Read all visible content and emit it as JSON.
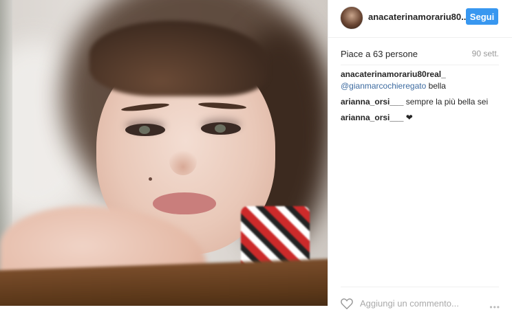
{
  "photo": {
    "subject": "portrait"
  },
  "post": {
    "username": "anacaterinamorariu80...",
    "follow_label": "Segui",
    "likes": "Piace a 63 persone",
    "time": "90 sett."
  },
  "comments": [
    {
      "user": "anacaterinamorariu80real_",
      "mention": "@gianmarcochieregato",
      "text": " bella"
    },
    {
      "user": "arianna_orsi___",
      "mention": "",
      "text": " sempre la più bella sei"
    },
    {
      "user": "arianna_orsi___",
      "mention": "",
      "text": " ❤"
    }
  ],
  "footer": {
    "add_comment_placeholder": "Aggiungi un commento...",
    "more_label": "•••"
  },
  "colors": {
    "accent": "#3897f0",
    "mention": "#3d6ba0",
    "muted": "#999999"
  },
  "icons": {
    "like": "heart-icon",
    "more": "more-options-icon"
  }
}
